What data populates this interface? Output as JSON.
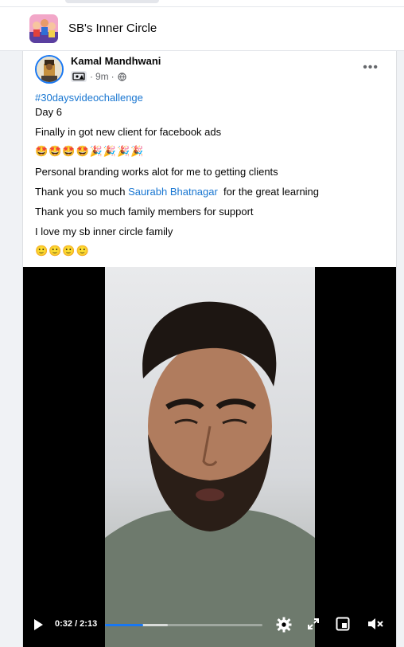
{
  "group": {
    "name": "SB's Inner Circle"
  },
  "post": {
    "author": "Kamal Mandhwani",
    "time": "9m",
    "separator": "·",
    "lines": {
      "hashtag": "#30daysvideochallenge",
      "day": "Day 6",
      "line1": "Finally in got new client for facebook ads",
      "emoji1": "🤩🤩🤩🤩🎉🎉🎉🎉",
      "line2": "Personal branding works alot for me to getting clients",
      "line3_pre": "Thank you so much ",
      "mention": "Saurabh Bhatnagar",
      "line3_post": "  for the great learning",
      "line4": "Thank you so much family members for support",
      "line5": "I love my sb inner circle family",
      "emoji2": "🙂🙂🙂🙂"
    }
  },
  "video": {
    "current_time": "0:32",
    "duration": "2:13",
    "time_display": "0:32 / 2:13",
    "progress_fraction": 0.24,
    "buffer_fraction": 0.4
  },
  "colors": {
    "link": "#1876d1",
    "accent": "#1877f2"
  }
}
